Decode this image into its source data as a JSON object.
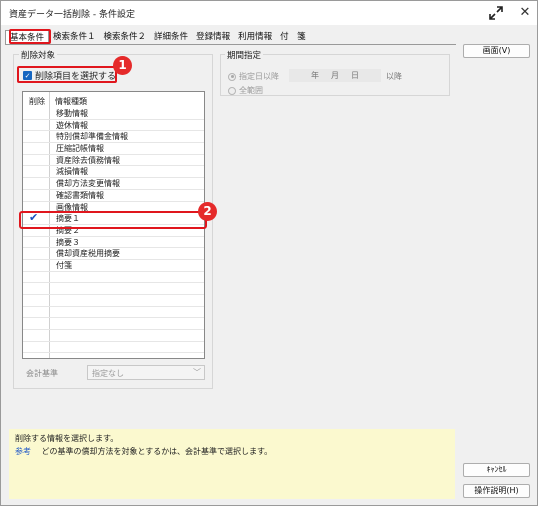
{
  "window": {
    "title": "資産データ一括削除 - 条件設定"
  },
  "tabs": [
    {
      "label": "基本条件"
    },
    {
      "label": "検索条件１"
    },
    {
      "label": "検索条件２"
    },
    {
      "label": "詳細条件"
    },
    {
      "label": "登録情報"
    },
    {
      "label": "利用情報"
    },
    {
      "label": "付　箋"
    }
  ],
  "left_group": {
    "title": "削除対象",
    "select_items_label": "削除項目を選択する",
    "columns": {
      "delete": "削除",
      "kind": "情報種類"
    },
    "rows": [
      {
        "label": "移動情報",
        "checked": false
      },
      {
        "label": "遊休情報",
        "checked": false
      },
      {
        "label": "特別償却準備金情報",
        "checked": false
      },
      {
        "label": "圧縮記帳情報",
        "checked": false
      },
      {
        "label": "資産除去債務情報",
        "checked": false
      },
      {
        "label": "減損情報",
        "checked": false
      },
      {
        "label": "償却方法変更情報",
        "checked": false
      },
      {
        "label": "確認書類情報",
        "checked": false
      },
      {
        "label": "画像情報",
        "checked": false
      },
      {
        "label": "摘要１",
        "checked": true
      },
      {
        "label": "摘要２",
        "checked": false
      },
      {
        "label": "摘要３",
        "checked": false
      },
      {
        "label": "償却資産税用摘要",
        "checked": false
      },
      {
        "label": "付箋",
        "checked": false
      }
    ],
    "accounting_label": "会計基準",
    "accounting_value": "指定なし"
  },
  "right_group": {
    "title": "期間指定",
    "radio_specified": "指定日以降",
    "radio_all": "全範囲",
    "date_year": "年",
    "date_month": "月",
    "date_day": "日",
    "date_suffix": "以降"
  },
  "buttons": {
    "screen": "画面(V)",
    "cancel": "ｷｬﾝｾﾙ",
    "help": "操作説明(H)"
  },
  "hint": {
    "line1": "削除する情報を選択します。",
    "ref_label": "参考",
    "line2": "どの基準の償却方法を対象とするかは、会計基準で選択します。"
  },
  "badges": [
    "1",
    "2"
  ],
  "colors": {
    "highlight": "#e0161d",
    "badge": "#e52a2a",
    "hint_bg": "#fbf9cf",
    "check": "#1a4fbf"
  }
}
